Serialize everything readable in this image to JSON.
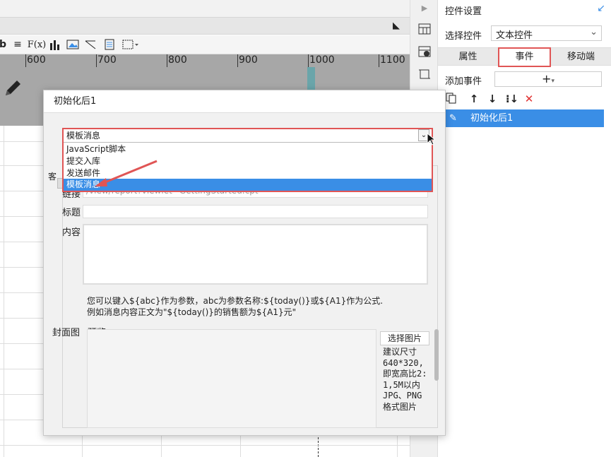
{
  "ruler": {
    "ticks": [
      "600",
      "700",
      "800",
      "900",
      "1000",
      "1100"
    ]
  },
  "toolbar": {
    "icons": [
      "align-icon",
      "formula-icon",
      "bar-chart-icon",
      "image-icon",
      "line-icon",
      "page-icon",
      "border-icon"
    ],
    "fx_label": "F(x)"
  },
  "right_panel": {
    "title": "控件设置",
    "select_label": "选择控件",
    "select_value": "文本控件",
    "tabs": [
      "属性",
      "事件",
      "移动端"
    ],
    "add_event_label": "添加事件",
    "add_event_plus": "+",
    "event_item": "初始化后1"
  },
  "dialog": {
    "title": "初始化后1",
    "combo": {
      "selected": "模板消息",
      "options": [
        "JavaScript脚本",
        "提交入库",
        "发送邮件",
        "模板消息"
      ],
      "highlighted_index": 3
    },
    "link_label": "链接",
    "link_value": "/view/report?viewlet=GettingStarted.cpt",
    "title_label": "标题",
    "content_label": "内容",
    "hint_line1": "您可以键入${abc}作为参数，abc为参数名称:${today()}或${A1}作为公式.",
    "hint_line2": "例如消息内容正文为\"${today()}的销售额为${A1}元\"",
    "cover_label": "封面图",
    "preview_label": "预览",
    "pick_button": "选择图片",
    "size_note": [
      "建议尺寸",
      "640*320,",
      "即宽高比2:",
      "1,5M以内",
      "JPG、PNG",
      "格式图片"
    ],
    "partial_label": "客"
  },
  "colors": {
    "accent": "#3a8ee6",
    "highlight_border": "#e05555",
    "ruler_bg": "#a7a7a7"
  }
}
